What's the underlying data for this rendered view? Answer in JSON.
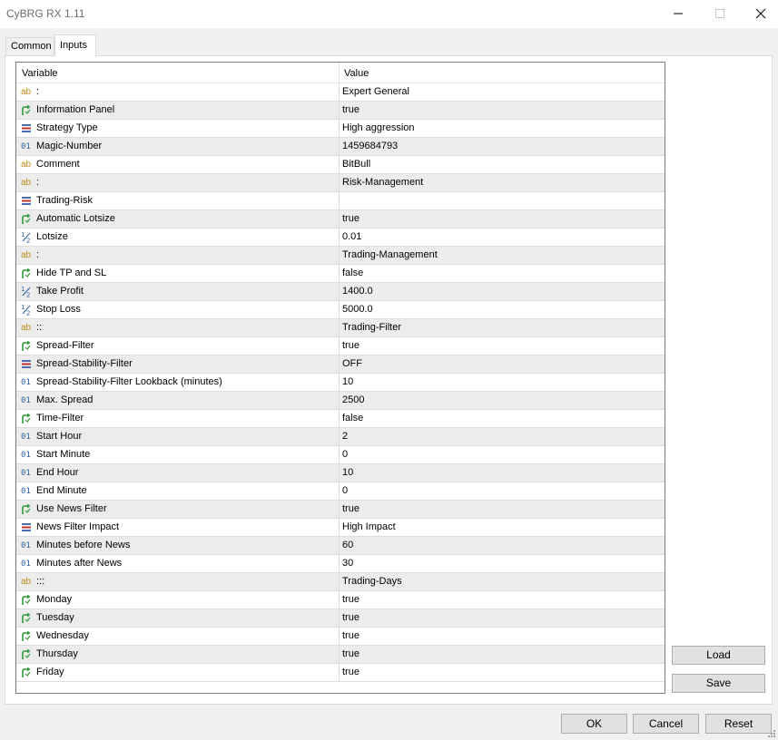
{
  "window": {
    "title": "CyBRG RX 1.11"
  },
  "tabs": [
    {
      "label": "Common",
      "active": false
    },
    {
      "label": "Inputs",
      "active": true
    }
  ],
  "grid": {
    "headers": {
      "variable": "Variable",
      "value": "Value"
    },
    "rows": [
      {
        "icon": "text-icon",
        "name": ":",
        "value": "Expert General"
      },
      {
        "icon": "boolean-icon",
        "name": "Information Panel",
        "value": "true"
      },
      {
        "icon": "enum-icon",
        "name": "Strategy Type",
        "value": "High aggression"
      },
      {
        "icon": "integer-icon",
        "name": "Magic-Number",
        "value": "1459684793"
      },
      {
        "icon": "text-icon",
        "name": "Comment",
        "value": "BitBull"
      },
      {
        "icon": "text-icon",
        "name": ":",
        "value": "Risk-Management"
      },
      {
        "icon": "enum-icon",
        "name": "Trading-Risk",
        "value": ""
      },
      {
        "icon": "boolean-icon",
        "name": "Automatic Lotsize",
        "value": "true"
      },
      {
        "icon": "double-icon",
        "name": "Lotsize",
        "value": "0.01"
      },
      {
        "icon": "text-icon",
        "name": ":",
        "value": "Trading-Management"
      },
      {
        "icon": "boolean-icon",
        "name": "Hide TP and SL",
        "value": "false"
      },
      {
        "icon": "double-icon",
        "name": "Take Profit",
        "value": "1400.0"
      },
      {
        "icon": "double-icon",
        "name": "Stop Loss",
        "value": "5000.0"
      },
      {
        "icon": "text-icon",
        "name": "::",
        "value": "Trading-Filter"
      },
      {
        "icon": "boolean-icon",
        "name": "Spread-Filter",
        "value": "true"
      },
      {
        "icon": "enum-icon",
        "name": "Spread-Stability-Filter",
        "value": "OFF"
      },
      {
        "icon": "integer-icon",
        "name": "Spread-Stability-Filter Lookback (minutes)",
        "value": "10"
      },
      {
        "icon": "integer-icon",
        "name": "Max. Spread",
        "value": "2500"
      },
      {
        "icon": "boolean-icon",
        "name": "Time-Filter",
        "value": "false"
      },
      {
        "icon": "integer-icon",
        "name": "Start Hour",
        "value": "2"
      },
      {
        "icon": "integer-icon",
        "name": "Start Minute",
        "value": "0"
      },
      {
        "icon": "integer-icon",
        "name": "End Hour",
        "value": "10"
      },
      {
        "icon": "integer-icon",
        "name": "End Minute",
        "value": "0"
      },
      {
        "icon": "boolean-icon",
        "name": "Use News Filter",
        "value": "true"
      },
      {
        "icon": "enum-icon",
        "name": "News Filter Impact",
        "value": "High Impact"
      },
      {
        "icon": "integer-icon",
        "name": "Minutes before News",
        "value": "60"
      },
      {
        "icon": "integer-icon",
        "name": "Minutes after News",
        "value": "30"
      },
      {
        "icon": "text-icon",
        "name": ":::",
        "value": "Trading-Days"
      },
      {
        "icon": "boolean-icon",
        "name": "Monday",
        "value": "true"
      },
      {
        "icon": "boolean-icon",
        "name": "Tuesday",
        "value": "true"
      },
      {
        "icon": "boolean-icon",
        "name": "Wednesday",
        "value": "true"
      },
      {
        "icon": "boolean-icon",
        "name": "Thursday",
        "value": "true"
      },
      {
        "icon": "boolean-icon",
        "name": "Friday",
        "value": "true"
      }
    ]
  },
  "buttons": {
    "load": "Load",
    "save": "Save",
    "ok": "OK",
    "cancel": "Cancel",
    "reset": "Reset"
  },
  "colors": {
    "text_icon": "#c08a1a",
    "integer_icon": "#2a5fa8",
    "boolean_icon": "#2e9b3a",
    "enum_icon": "#4a6fb5",
    "alt_row": "#ececec"
  }
}
